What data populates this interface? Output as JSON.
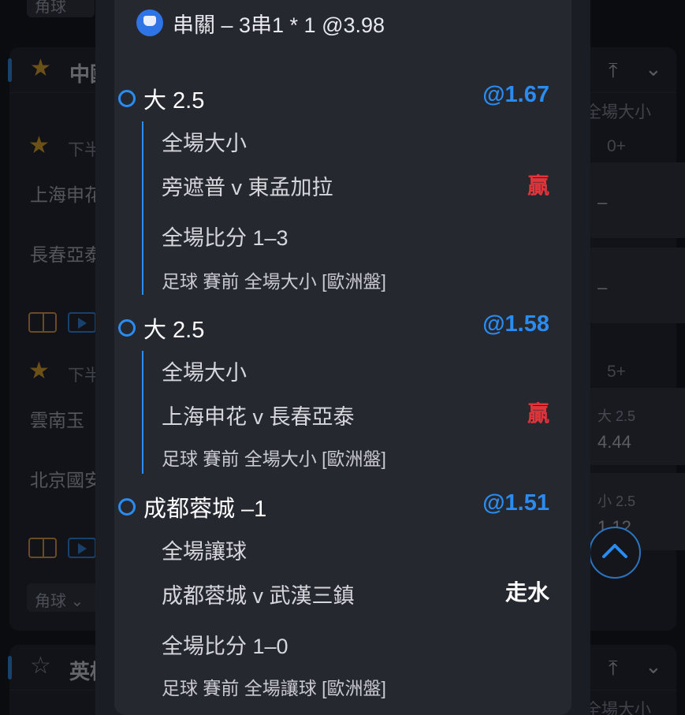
{
  "background": {
    "cards": [
      {
        "league": "中國",
        "icons": {
          "star": "star-filled-icon",
          "pin": "pin-top-icon",
          "collapse": "chevron-down-icon"
        },
        "column_header": "全場大小",
        "matches": [
          {
            "status": "下半",
            "count": "0+",
            "home": "上海申花",
            "away": "長春亞泰",
            "odds": [
              "–",
              "–"
            ]
          },
          {
            "status": "下半",
            "count": "5+",
            "home": "雲南玉",
            "away": "北京國安",
            "odds": [
              {
                "label": "大 2.5",
                "value": "4.44"
              },
              {
                "label": "小 2.5",
                "value": "1.12"
              }
            ]
          }
        ]
      },
      {
        "league": "英格",
        "icons": {
          "star": "star-outline-icon"
        },
        "column_header": "全場大小"
      }
    ],
    "corner_select": "角球",
    "top_select": "角球"
  },
  "modal": {
    "title": "串關 – 3串1 * 1 @3.98",
    "selections": [
      {
        "pick": "大 2.5",
        "odds": "@1.67",
        "market": "全場大小",
        "match": "旁遮普 v 東孟加拉",
        "result": "贏",
        "score": "全場比分 1–3",
        "meta": "足球  賽前    全場大小 [歐洲盤]"
      },
      {
        "pick": "大 2.5",
        "odds": "@1.58",
        "market": "全場大小",
        "match": "上海申花 v 長春亞泰",
        "result": "贏",
        "meta": "足球  賽前    全場大小 [歐洲盤]"
      },
      {
        "pick": "成都蓉城 –1",
        "odds": "@1.51",
        "market": "全場讓球",
        "match": "成都蓉城 v 武漢三鎮",
        "result": "走水",
        "score": "全場比分 1–0",
        "meta": "足球  賽前    全場讓球 [歐洲盤]"
      }
    ]
  },
  "colors": {
    "accent": "#2a8cf0",
    "win": "#e0333a",
    "push": "#ffffff",
    "star": "#f0b020"
  }
}
